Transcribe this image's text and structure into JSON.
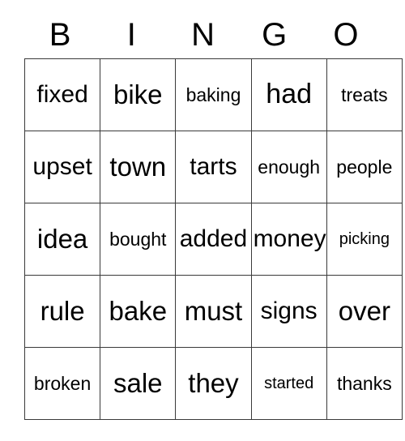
{
  "card": {
    "type": "bingo-card",
    "title_letters": [
      "B",
      "I",
      "N",
      "G",
      "O"
    ],
    "columns": 5,
    "rows": 5,
    "colors": {
      "background": "#ffffff",
      "border": "#3a3a3a",
      "text": "#000000"
    },
    "grid": [
      [
        {
          "word": "fixed"
        },
        {
          "word": "bike"
        },
        {
          "word": "baking"
        },
        {
          "word": "had"
        },
        {
          "word": "treats"
        }
      ],
      [
        {
          "word": "upset"
        },
        {
          "word": "town"
        },
        {
          "word": "tarts"
        },
        {
          "word": "enough"
        },
        {
          "word": "people"
        }
      ],
      [
        {
          "word": "idea"
        },
        {
          "word": "bought"
        },
        {
          "word": "added"
        },
        {
          "word": "money"
        },
        {
          "word": "picking"
        }
      ],
      [
        {
          "word": "rule"
        },
        {
          "word": "bake"
        },
        {
          "word": "must"
        },
        {
          "word": "signs"
        },
        {
          "word": "over"
        }
      ],
      [
        {
          "word": "broken"
        },
        {
          "word": "sale"
        },
        {
          "word": "they"
        },
        {
          "word": "started"
        },
        {
          "word": "thanks"
        }
      ]
    ]
  }
}
